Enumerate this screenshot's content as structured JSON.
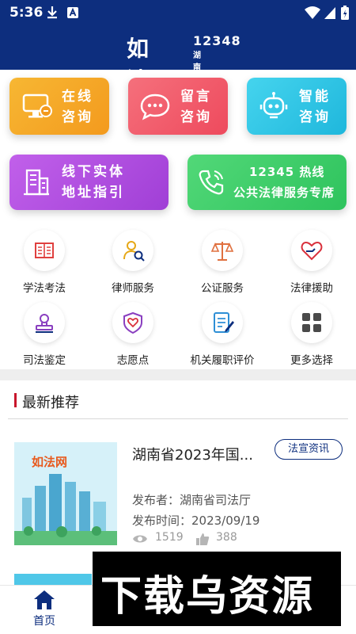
{
  "status": {
    "time": "5:36"
  },
  "header": {
    "logo": "如法网",
    "hotline": "12348",
    "subtitle": "湖南法网"
  },
  "cards": {
    "online": {
      "line1": "在线",
      "line2": "咨询",
      "color": "#f5a623"
    },
    "message": {
      "line1": "留言",
      "line2": "咨询",
      "color": "#f25a6a"
    },
    "smart": {
      "line1": "智能",
      "line2": "咨询",
      "color": "#2ec5e6"
    },
    "offline": {
      "line1": "线下实体",
      "line2": "地址指引",
      "color": "#b34fe0"
    },
    "hotline": {
      "line1": "12345 热线",
      "line2": "公共法律服务专席",
      "color": "#3fcf6a"
    }
  },
  "grid": {
    "items": [
      {
        "label": "学法考法",
        "icon": "book-icon"
      },
      {
        "label": "律师服务",
        "icon": "lawyer-search-icon"
      },
      {
        "label": "公证服务",
        "icon": "scales-icon"
      },
      {
        "label": "法律援助",
        "icon": "heart-help-icon"
      },
      {
        "label": "司法鉴定",
        "icon": "magnifier-stamp-icon"
      },
      {
        "label": "志愿点",
        "icon": "volunteer-shield-icon"
      },
      {
        "label": "机关履职评价",
        "icon": "document-edit-icon"
      },
      {
        "label": "更多选择",
        "icon": "more-grid-icon"
      }
    ]
  },
  "section": {
    "title": "最新推荐"
  },
  "news": {
    "title": "湖南省2023年国...",
    "tag": "法宣资讯",
    "publisher": "发布者：湖南省司法厅",
    "date": "发布时间：2023/09/19",
    "views": "1519",
    "likes": "388"
  },
  "nav": {
    "home": "首页"
  },
  "watermark": {
    "text": "下载乌资源"
  },
  "colors": {
    "primary": "#0d2e7e",
    "accent_red": "#c8162c"
  }
}
